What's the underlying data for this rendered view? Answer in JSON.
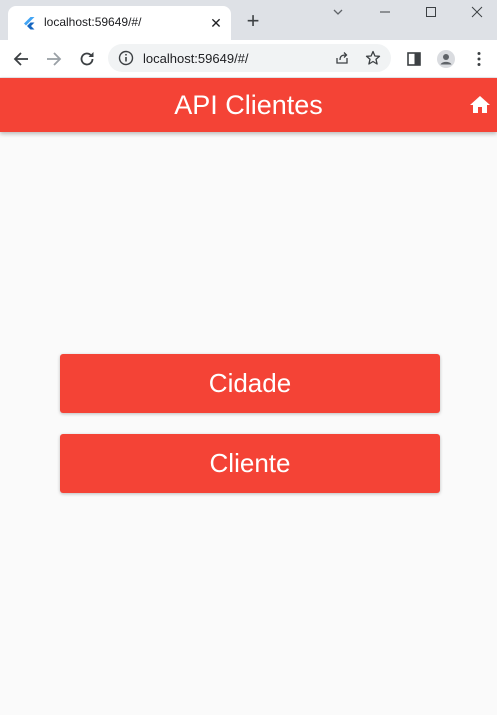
{
  "browser": {
    "tab_title": "localhost:59649/#/",
    "url": "localhost:59649/#/"
  },
  "app": {
    "title": "API Clientes",
    "accent_color": "#f44336"
  },
  "buttons": {
    "cidade": "Cidade",
    "cliente": "Cliente"
  },
  "icons": {
    "home": "home-icon"
  }
}
